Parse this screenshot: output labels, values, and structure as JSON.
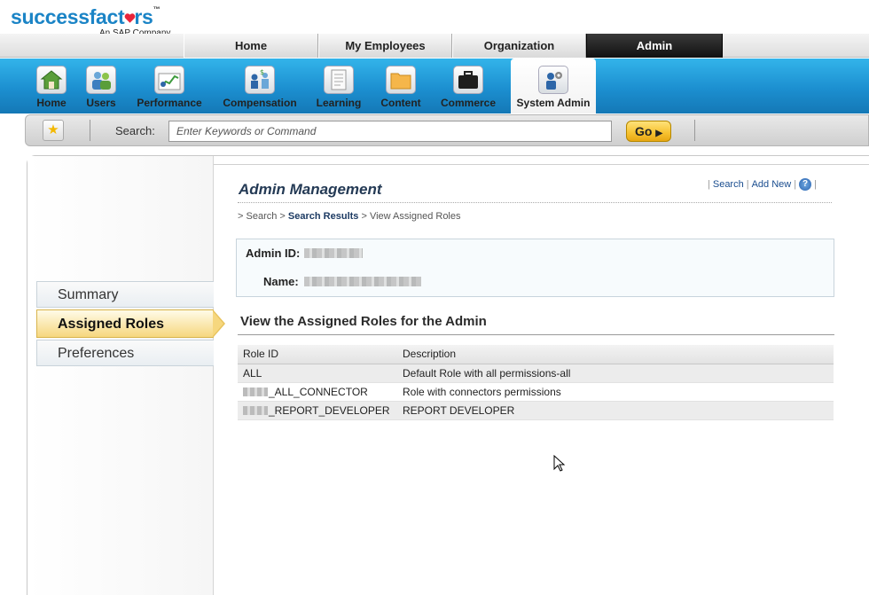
{
  "brand": {
    "name_prefix": "successfact",
    "name_suffix": "rs",
    "tagline": "An SAP Company",
    "tm": "™",
    "accent": "#1b84c6",
    "heart_color": "#e8243a"
  },
  "top_tabs": [
    {
      "label": "Home"
    },
    {
      "label": "My Employees"
    },
    {
      "label": "Organization"
    },
    {
      "label": "Admin",
      "active": true
    }
  ],
  "modules": [
    {
      "label": "Home",
      "icon": "house-icon"
    },
    {
      "label": "Users",
      "icon": "users-icon"
    },
    {
      "label": "Performance",
      "icon": "performance-chart-icon"
    },
    {
      "label": "Compensation",
      "icon": "compensation-icon"
    },
    {
      "label": "Learning",
      "icon": "document-icon"
    },
    {
      "label": "Content",
      "icon": "folder-icon"
    },
    {
      "label": "Commerce",
      "icon": "briefcase-icon"
    },
    {
      "label": "System Admin",
      "icon": "system-admin-icon",
      "active": true
    }
  ],
  "search": {
    "label": "Search:",
    "placeholder": "Enter Keywords or Command",
    "go_label": "Go"
  },
  "sidebar": {
    "items": [
      {
        "label": "Summary"
      },
      {
        "label": "Assigned Roles",
        "active": true
      },
      {
        "label": "Preferences"
      }
    ]
  },
  "main": {
    "title": "Admin Management",
    "links": {
      "search": "Search",
      "add_new": "Add New",
      "help": "?"
    },
    "breadcrumb": {
      "sep": ">",
      "items": [
        "Search",
        "Search Results",
        "View Assigned Roles"
      ]
    },
    "admin": {
      "id_label": "Admin ID:",
      "name_label": "Name:"
    },
    "section_title": "View the Assigned Roles for the Admin",
    "table": {
      "headers": [
        "Role ID",
        "Description"
      ],
      "rows": [
        {
          "role_id": "ALL",
          "description": "Default Role with all permissions-all",
          "redacted_prefix": false
        },
        {
          "role_id": "_ALL_CONNECTOR",
          "description": "Role with connectors permissions",
          "redacted_prefix": true
        },
        {
          "role_id": "_REPORT_DEVELOPER",
          "description": "REPORT DEVELOPER",
          "redacted_prefix": true
        }
      ]
    }
  }
}
